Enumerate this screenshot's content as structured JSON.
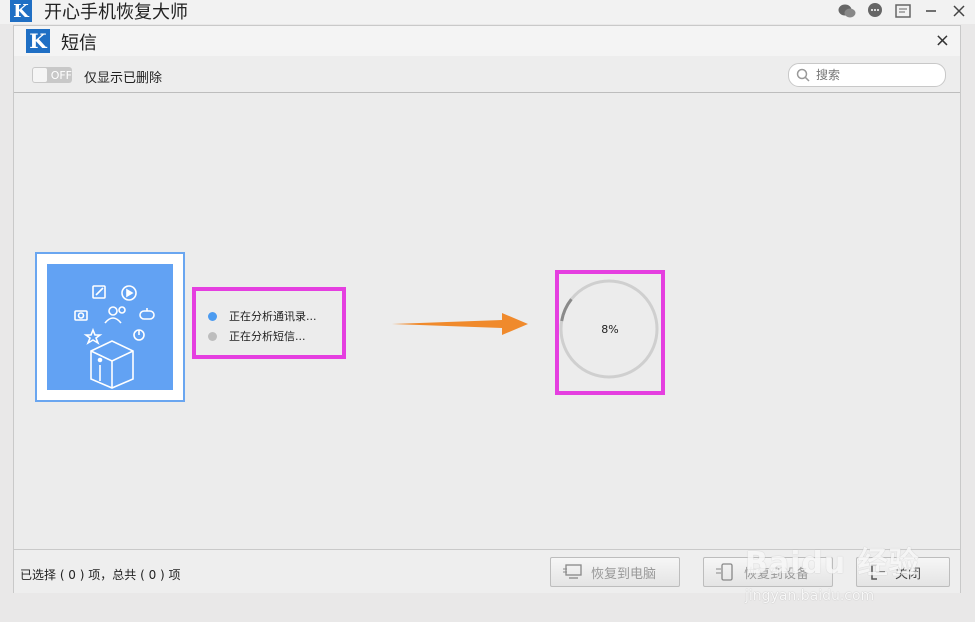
{
  "app": {
    "title": "开心手机恢复大师",
    "logo_letter": "K"
  },
  "dialog": {
    "title": "短信",
    "logo_letter": "K",
    "close_glyph": "×"
  },
  "toolbar": {
    "toggle_state": "OFF",
    "toggle_label": "仅显示已删除",
    "search_placeholder": "搜索"
  },
  "status": {
    "items": [
      {
        "label": "正在分析通讯录...",
        "color": "#4c9bf0"
      },
      {
        "label": "正在分析短信...",
        "color": "#bdbdbd"
      }
    ]
  },
  "progress": {
    "value": 0.08,
    "label": "8%"
  },
  "footer": {
    "status": "已选择 ( 0 ) 项，总共 ( 0 ) 项",
    "restore_button": "恢复到电脑",
    "device_button": "恢复到设备",
    "close_button": "关闭"
  },
  "watermark": {
    "brand": "Baidu 经验",
    "url": "jingyan.baidu.com"
  },
  "colors": {
    "highlight": "#e53fe0",
    "accent": "#62a2f3",
    "arrow": "#f08a2c"
  }
}
